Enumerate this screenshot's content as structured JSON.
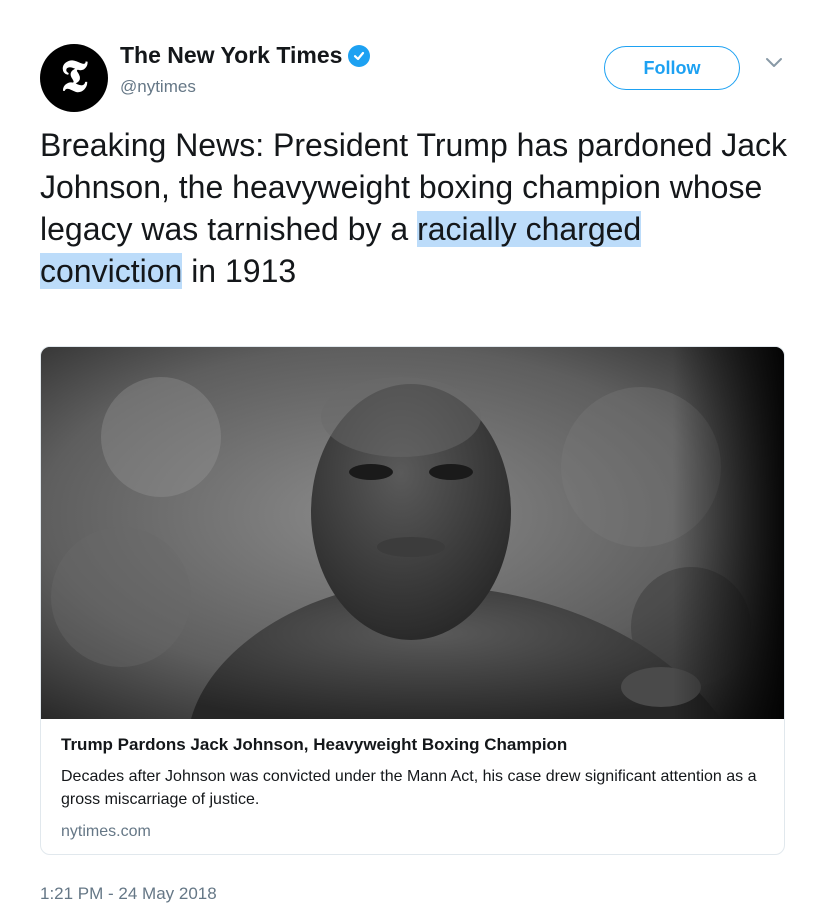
{
  "account": {
    "display_name": "The New York Times",
    "handle": "@nytimes",
    "avatar_glyph": "𝕿",
    "verified": true
  },
  "actions": {
    "follow_label": "Follow"
  },
  "tweet": {
    "text_before": "Breaking News: President Trump has pardoned Jack Johnson, the heavyweight boxing champion whose legacy was tarnished by a ",
    "text_highlighted": "racially charged conviction",
    "text_after": " in 1913",
    "timestamp": "1:21 PM - 24 May 2018"
  },
  "card": {
    "title": "Trump Pardons Jack Johnson, Heavyweight Boxing Champion",
    "description": "Decades after Johnson was convicted under the Mann Act, his case drew significant attention as a gross miscarriage of justice.",
    "domain": "nytimes.com"
  },
  "colors": {
    "accent": "#1da1f2",
    "text": "#14171a",
    "secondary_text": "#657786",
    "highlight": "#bcdcfa"
  }
}
